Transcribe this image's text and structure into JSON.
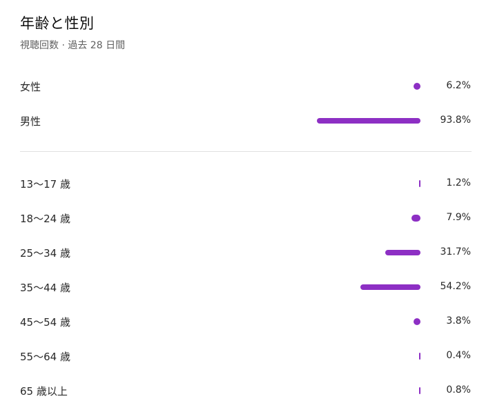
{
  "header": {
    "title": "年齢と性別",
    "subtitle": "視聴回数 · 過去 28 日間"
  },
  "colors": {
    "bar": "#8d2fc4"
  },
  "chart_data": [
    {
      "type": "bar",
      "orientation": "horizontal",
      "categories": [
        "女性",
        "男性"
      ],
      "values": [
        6.2,
        93.8
      ],
      "labels": [
        "6.2%",
        "93.8%"
      ],
      "unit": "%"
    },
    {
      "type": "bar",
      "orientation": "horizontal",
      "categories": [
        "13〜17 歳",
        "18〜24 歳",
        "25〜34 歳",
        "35〜44 歳",
        "45〜54 歳",
        "55〜64 歳",
        "65 歳以上"
      ],
      "values": [
        1.2,
        7.9,
        31.7,
        54.2,
        3.8,
        0.4,
        0.8
      ],
      "labels": [
        "1.2%",
        "7.9%",
        "31.7%",
        "54.2%",
        "3.8%",
        "0.4%",
        "0.8%"
      ],
      "unit": "%"
    }
  ]
}
